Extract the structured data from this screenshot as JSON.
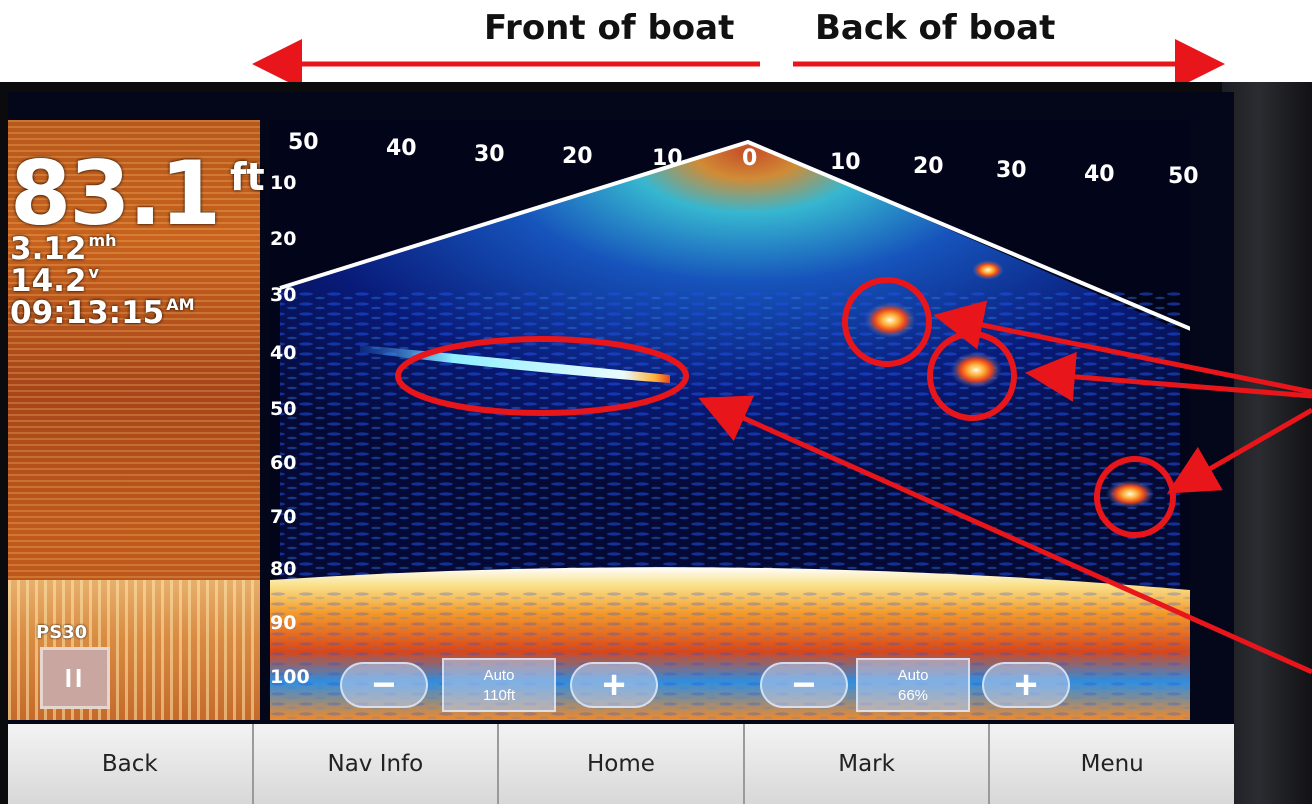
{
  "annotations": {
    "front_label": "Front of boat",
    "back_label": "Back of boat",
    "arrow_color": "#e8151b"
  },
  "sidebar": {
    "depth_value": "83.1",
    "depth_unit": "ft",
    "speed_value": "3.12",
    "speed_unit": "mh",
    "voltage_value": "14.2",
    "voltage_unit": "v",
    "time_value": "09:13:15",
    "time_unit": "AM",
    "transducer_label": "PS30",
    "pause_icon": "II"
  },
  "scale": {
    "range_labels": [
      "50",
      "40",
      "30",
      "20",
      "10",
      "0",
      "10",
      "20",
      "30",
      "40",
      "50"
    ],
    "depth_labels": [
      "10",
      "20",
      "30",
      "40",
      "50",
      "60",
      "70",
      "80",
      "90",
      "100"
    ]
  },
  "zoom_depth": {
    "minus_label": "−",
    "mode": "Auto",
    "value": "110ft",
    "plus_label": "+"
  },
  "zoom_gain": {
    "minus_label": "−",
    "mode": "Auto",
    "value": "66%",
    "plus_label": "+"
  },
  "menu": {
    "items": [
      "Back",
      "Nav Info",
      "Home",
      "Mark",
      "Menu"
    ]
  },
  "colors": {
    "screen_background": "#04061a",
    "sidebar_orange": "#c05a1c",
    "menu_bar": "#e6e6e6"
  }
}
